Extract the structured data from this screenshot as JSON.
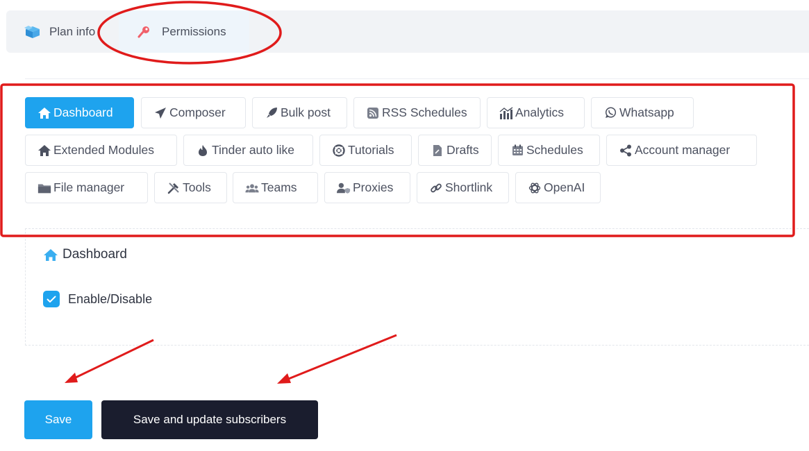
{
  "tabs": [
    {
      "label": "Plan info",
      "icon": "box-icon"
    },
    {
      "label": "Permissions",
      "icon": "pushpin-icon",
      "active": true
    }
  ],
  "modules": [
    {
      "label": "Dashboard",
      "icon": "home-icon",
      "active": true
    },
    {
      "label": "Composer",
      "icon": "paper-plane-icon"
    },
    {
      "label": "Bulk post",
      "icon": "rocket-icon"
    },
    {
      "label": "RSS Schedules",
      "icon": "rss-icon"
    },
    {
      "label": "Analytics",
      "icon": "chart-icon"
    },
    {
      "label": "Whatsapp",
      "icon": "whatsapp-icon"
    },
    {
      "label": "Extended Modules",
      "icon": "home-icon"
    },
    {
      "label": "Tinder auto like",
      "icon": "flame-icon"
    },
    {
      "label": "Tutorials",
      "icon": "lifebuoy-icon"
    },
    {
      "label": "Drafts",
      "icon": "file-icon"
    },
    {
      "label": "Schedules",
      "icon": "calendar-icon"
    },
    {
      "label": "Account manager",
      "icon": "share-icon"
    },
    {
      "label": "File manager",
      "icon": "folder-icon"
    },
    {
      "label": "Tools",
      "icon": "tools-icon"
    },
    {
      "label": "Teams",
      "icon": "users-icon"
    },
    {
      "label": "Proxies",
      "icon": "user-shield-icon"
    },
    {
      "label": "Shortlink",
      "icon": "link-icon"
    },
    {
      "label": "OpenAI",
      "icon": "openai-icon"
    }
  ],
  "panel": {
    "title": "Dashboard",
    "toggle_label": "Enable/Disable",
    "toggle_checked": true
  },
  "buttons": {
    "save": "Save",
    "save_update": "Save and update subscribers"
  },
  "colors": {
    "accent": "#1ea3ee",
    "dark_button": "#1a1d2e",
    "annotation": "#e01b1b"
  }
}
